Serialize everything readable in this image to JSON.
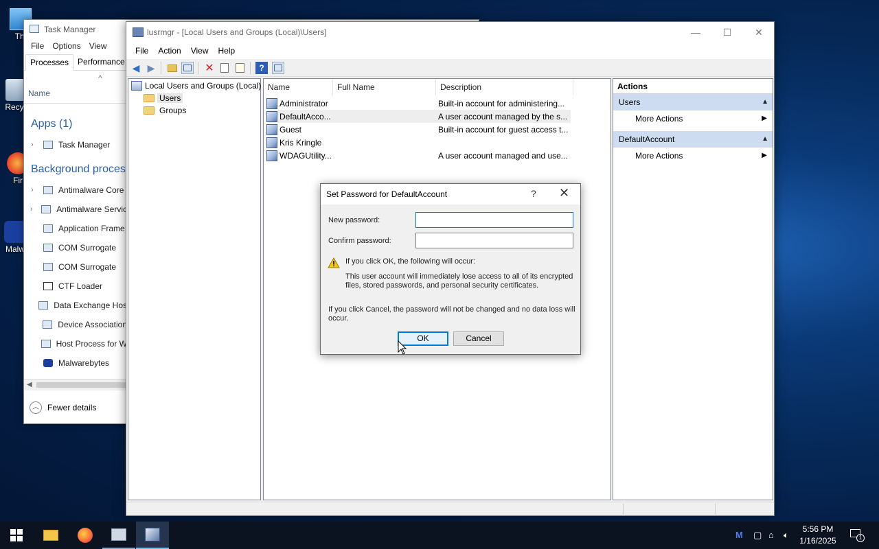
{
  "desktop": {
    "icons": [
      {
        "label": "Thi"
      },
      {
        "label": "Recyc"
      },
      {
        "label": "Fir"
      },
      {
        "label": "Malw"
      }
    ]
  },
  "task_manager": {
    "title": "Task Manager",
    "menu": [
      "File",
      "Options",
      "View"
    ],
    "tabs": [
      "Processes",
      "Performance"
    ],
    "sort_glyph": "^",
    "column_name": "Name",
    "apps_group": "Apps (1)",
    "app_rows": [
      {
        "label": "Task Manager",
        "expand": "›"
      }
    ],
    "bg_group": "Background process",
    "bg_rows": [
      {
        "label": "Antimalware Core",
        "expand": "›"
      },
      {
        "label": "Antimalware Servic",
        "expand": "›"
      },
      {
        "label": "Application Frame",
        "expand": ""
      },
      {
        "label": "COM Surrogate",
        "expand": ""
      },
      {
        "label": "COM Surrogate",
        "expand": ""
      },
      {
        "label": "CTF Loader",
        "expand": ""
      },
      {
        "label": "Data Exchange Hos",
        "expand": ""
      },
      {
        "label": "Device Association",
        "expand": ""
      },
      {
        "label": "Host Process for W",
        "expand": ""
      },
      {
        "label": "Malwarebytes",
        "expand": ""
      }
    ],
    "fewer_details": "Fewer details"
  },
  "lusrmgr": {
    "title": "lusrmgr - [Local Users and Groups (Local)\\Users]",
    "menu": [
      "File",
      "Action",
      "View",
      "Help"
    ],
    "tree": {
      "root": "Local Users and Groups (Local)",
      "children": [
        "Users",
        "Groups"
      ]
    },
    "columns": [
      "Name",
      "Full Name",
      "Description"
    ],
    "users": [
      {
        "name": "Administrator",
        "full_name": "",
        "description": "Built-in account for administering..."
      },
      {
        "name": "DefaultAcco...",
        "full_name": "",
        "description": "A user account managed by the s..."
      },
      {
        "name": "Guest",
        "full_name": "",
        "description": "Built-in account for guest access t..."
      },
      {
        "name": "Kris Kringle",
        "full_name": "",
        "description": ""
      },
      {
        "name": "WDAGUtility...",
        "full_name": "",
        "description": "A user account managed and use..."
      }
    ],
    "actions": {
      "header": "Actions",
      "sections": [
        {
          "title": "Users",
          "item": "More Actions"
        },
        {
          "title": "DefaultAccount",
          "item": "More Actions"
        }
      ]
    }
  },
  "dialog": {
    "title": "Set Password for DefaultAccount",
    "help": "?",
    "close": "✕",
    "new_password_label": "New password:",
    "new_password_value": "",
    "confirm_password_label": "Confirm password:",
    "confirm_password_value": "",
    "warning_heading": "If you click OK, the following will occur:",
    "warning_line1": "This user account will immediately lose access to all of its encrypted",
    "warning_line2": "files, stored passwords, and personal security certificates.",
    "cancel_note_line1": "If you click Cancel, the password will not be changed and no data loss will",
    "cancel_note_line2": "occur.",
    "ok_label": "OK",
    "cancel_label": "Cancel"
  },
  "taskbar": {
    "time": "5:56 PM",
    "date": "1/16/2025",
    "notification_count": "1"
  },
  "colors": {
    "accent": "#0078d7",
    "actions_section": "#cddcf0",
    "desktop": "#062a5a"
  }
}
